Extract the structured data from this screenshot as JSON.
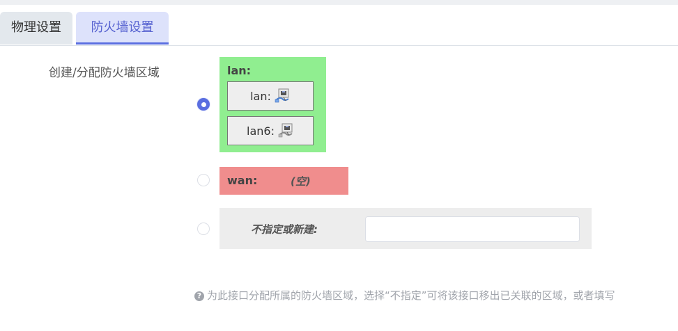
{
  "tabs": {
    "physical": "物理设置",
    "firewall": "防火墙设置"
  },
  "field_label": "创建/分配防火墙区域",
  "zones": {
    "lan": {
      "title": "lan:",
      "interfaces": [
        "lan:",
        "lan6:"
      ],
      "color": "#90ee90",
      "selected": true
    },
    "wan": {
      "title": "wan:",
      "empty_text": "(空)",
      "color": "#f08d8d"
    },
    "new": {
      "label": "不指定或新建:",
      "input_value": ""
    }
  },
  "help_text": "为此接口分配所属的防火墙区域，选择“不指定”可将该接口移出已关联的区域，或者填写",
  "colors": {
    "accent": "#5a6ee0"
  },
  "icons": {
    "interface": "network-port-icon",
    "help": "question-circle-icon"
  }
}
